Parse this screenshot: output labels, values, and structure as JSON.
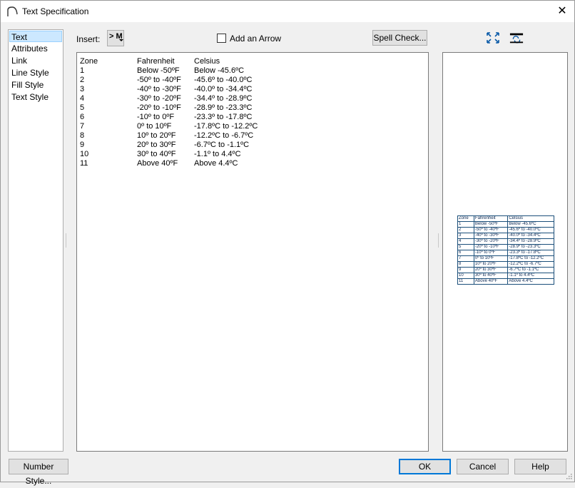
{
  "window": {
    "title": "Text Specification"
  },
  "nav": {
    "items": [
      "Text",
      "Attributes",
      "Link",
      "Line Style",
      "Fill Style",
      "Text Style"
    ]
  },
  "toolbar": {
    "insert_label": "Insert:",
    "insert_button": "> M",
    "arrow_checkbox_label": "Add an Arrow",
    "arrow_checked": false,
    "spell_check": "Spell Check..."
  },
  "editor": {
    "rows": [
      [
        "Zone",
        "Fahrenheit",
        "Celsius"
      ],
      [
        "1",
        "Below -50ºF",
        "Below -45.6ºC"
      ],
      [
        "2",
        "-50º to -40ºF",
        "-45.6º to -40.0ºC"
      ],
      [
        "3",
        "-40º to -30ºF",
        "-40.0º to -34.4ºC"
      ],
      [
        "4",
        "-30º to -20ºF",
        "-34.4º to -28.9ºC"
      ],
      [
        "5",
        "-20º to -10ºF",
        "-28.9º to -23.3ºC"
      ],
      [
        "6",
        "-10º to 0ºF",
        "-23.3º to -17.8ºC"
      ],
      [
        "7",
        "0º to 10ºF",
        "-17.8ºC to -12.2ºC"
      ],
      [
        "8",
        "10º to 20ºF",
        "-12.2ºC to -6.7ºC"
      ],
      [
        "9",
        "20º to 30ºF",
        "-6.7ºC to -1.1ºC"
      ],
      [
        "10",
        "30º to 40ºF",
        "-1.1º to 4.4ºC"
      ],
      [
        "11",
        "Above 40ºF",
        "Above 4.4ºC"
      ]
    ]
  },
  "buttons": {
    "number_style": "Number Style...",
    "ok": "OK",
    "cancel": "Cancel",
    "help": "Help"
  },
  "icons": {
    "fit": "fit-to-window-icon",
    "refresh": "refresh-preview-icon",
    "close": "close-icon"
  },
  "colors": {
    "selection": "#cce8ff",
    "default_button_border": "#0078d7",
    "preview_table": "#1b4f7a"
  }
}
